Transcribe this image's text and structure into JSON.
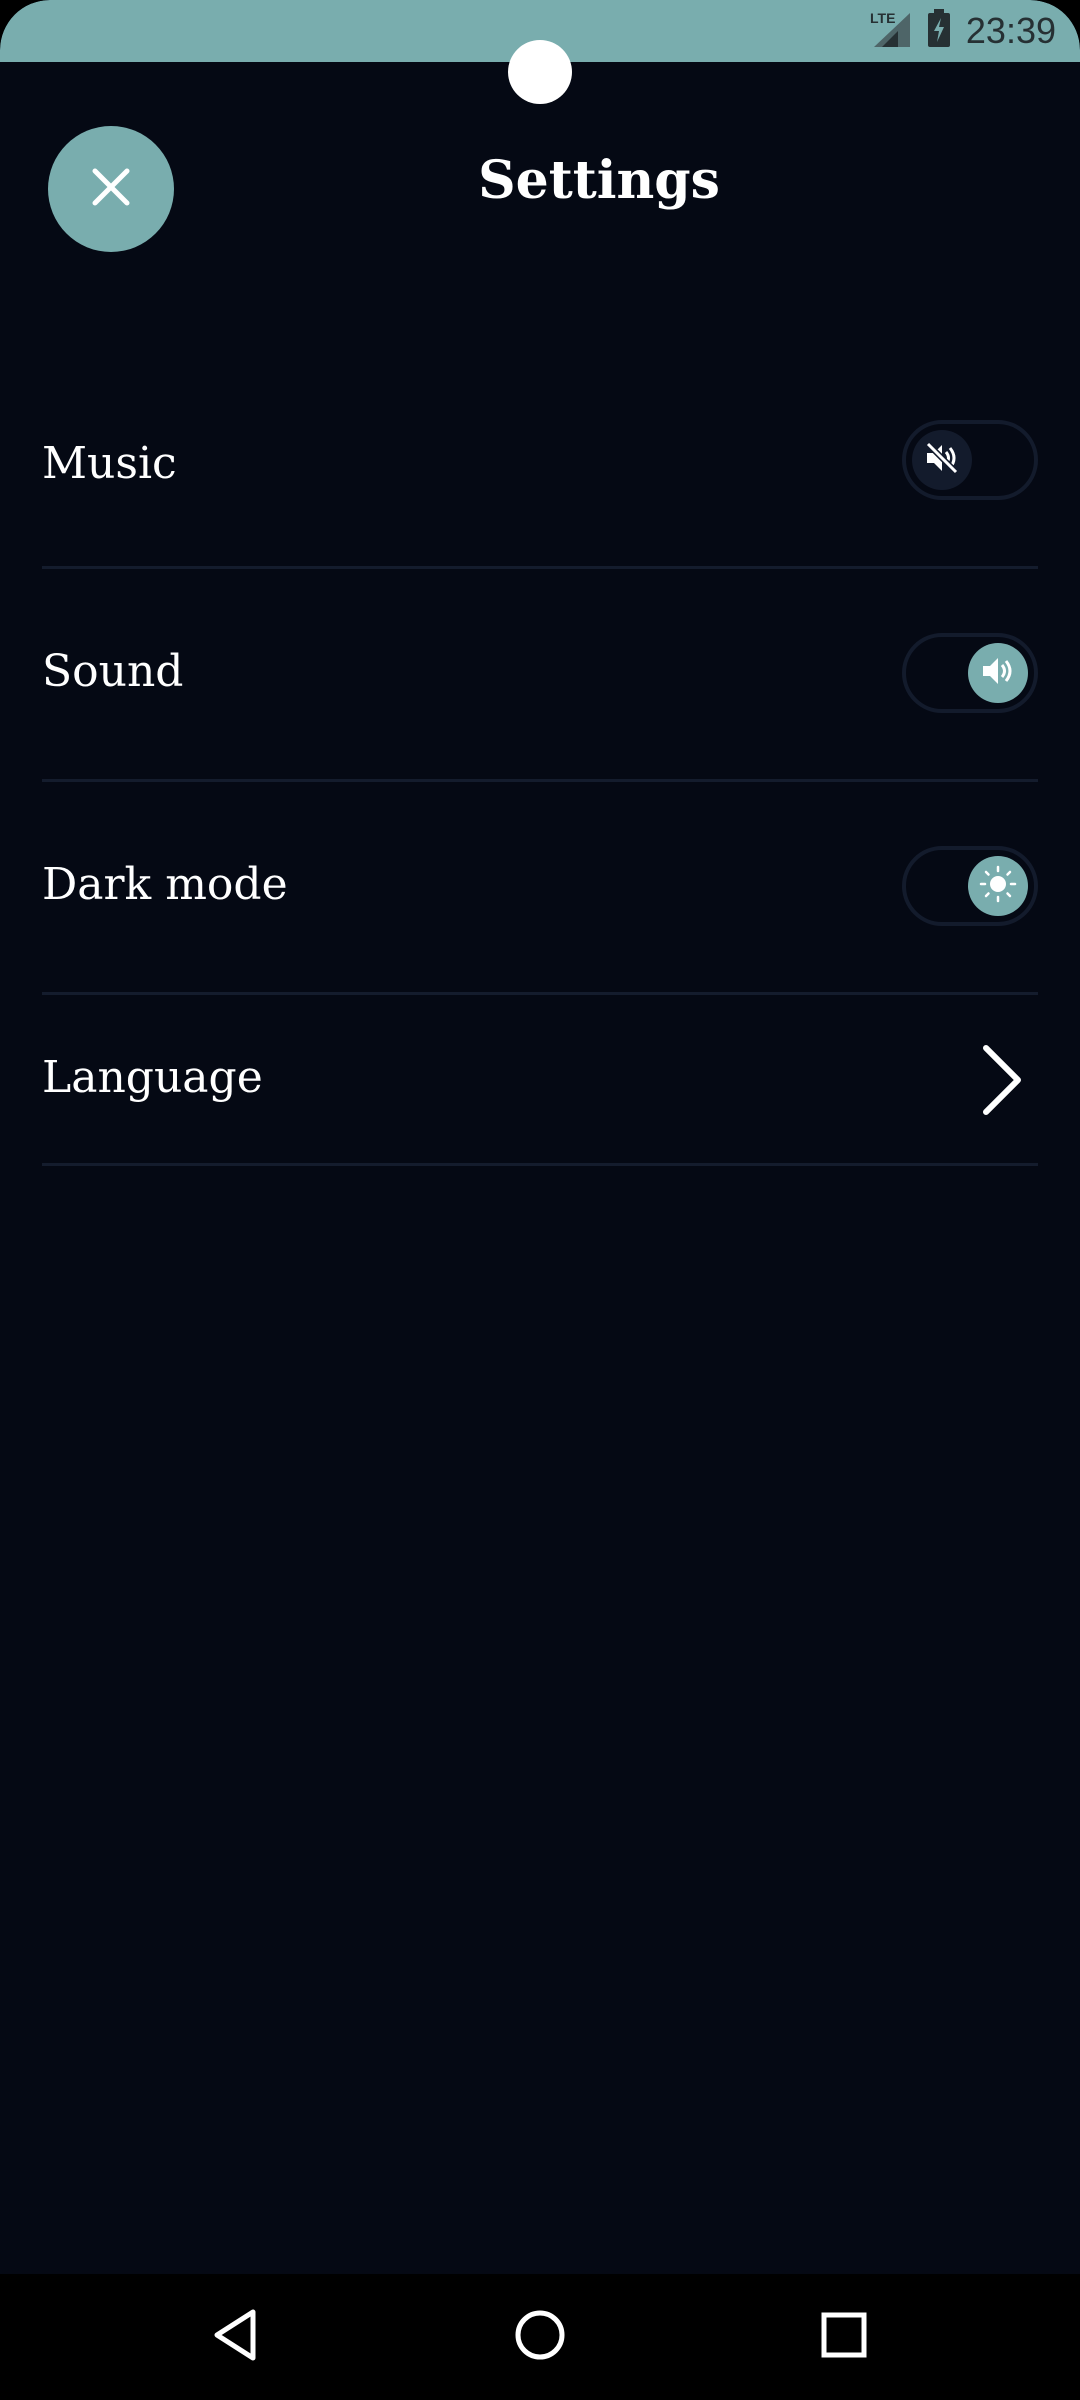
{
  "status_bar": {
    "network": "LTE",
    "time": "23:39",
    "background_color": "#79adae",
    "icons": [
      "lte-signal-icon",
      "battery-charging-icon"
    ]
  },
  "header": {
    "title": "Settings",
    "close_icon": "close-icon",
    "accent_color": "#79adae"
  },
  "settings": {
    "items": [
      {
        "label": "Music",
        "control": "toggle",
        "state": "off",
        "icon": "volume-muted-icon"
      },
      {
        "label": "Sound",
        "control": "toggle",
        "state": "on",
        "icon": "volume-on-icon"
      },
      {
        "label": "Dark mode",
        "control": "toggle",
        "state": "on",
        "icon": "sun-icon"
      },
      {
        "label": "Language",
        "control": "link",
        "icon": "chevron-right-icon"
      }
    ]
  },
  "nav_bar": {
    "buttons": [
      "back-icon",
      "home-icon",
      "recents-icon"
    ]
  },
  "colors": {
    "background": "#050914",
    "divider": "#141c2d",
    "text": "#ffffff"
  }
}
